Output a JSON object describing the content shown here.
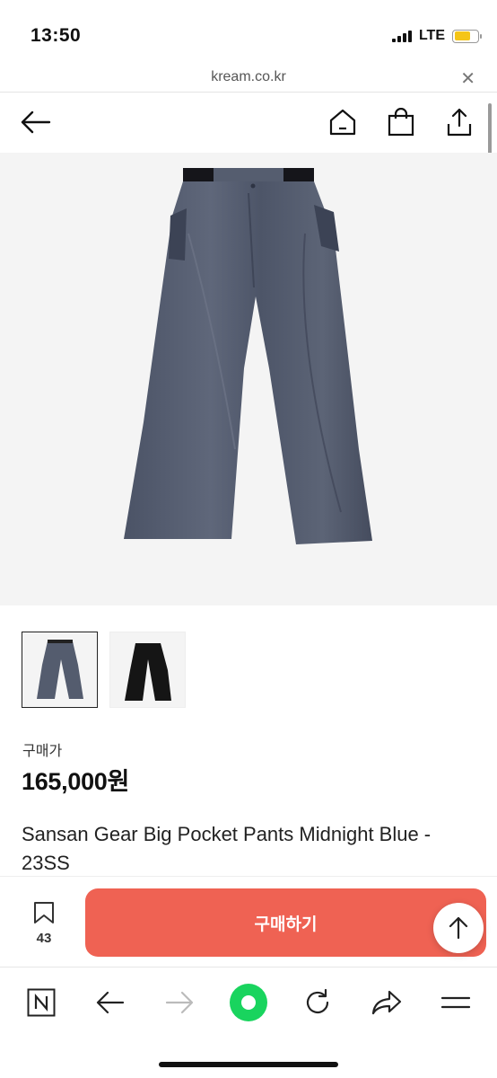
{
  "status": {
    "time": "13:50",
    "network": "LTE",
    "battery_color": "#f5c518"
  },
  "browser": {
    "url": "kream.co.kr",
    "close_icon": "close-icon"
  },
  "nav": {
    "back_icon": "back-arrow-icon",
    "home_icon": "home-icon",
    "shop_icon": "shopping-bag-icon",
    "share_icon": "share-icon"
  },
  "product": {
    "thumbnails": [
      {
        "name": "midnight-blue",
        "color": "#545c6e"
      },
      {
        "name": "black",
        "color": "#151515"
      }
    ],
    "price_label": "구매가",
    "price": "165,000원",
    "name": "Sansan Gear Big Pocket Pants Midnight Blue - 23SS"
  },
  "action_bar": {
    "bookmark_count": "43",
    "buy_label": "구매하기",
    "buy_color": "#ef6253"
  },
  "toolbar": {
    "icons": [
      "naver-n-icon",
      "back-icon",
      "forward-icon",
      "green-dot-icon",
      "refresh-icon",
      "share-icon",
      "menu-icon"
    ],
    "accent_green": "#19d45e"
  }
}
